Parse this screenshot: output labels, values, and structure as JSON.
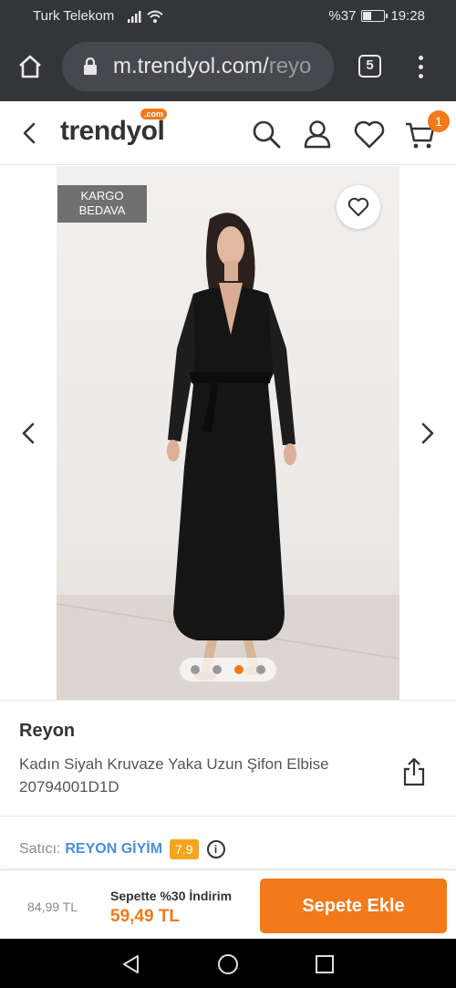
{
  "status_bar": {
    "carrier": "Turk Telekom",
    "battery": "%37",
    "time": "19:28",
    "battery_level": 0.37
  },
  "browser": {
    "url_main": "m.trendyol.com/",
    "url_rest": "reyo",
    "tab_count": "5"
  },
  "header": {
    "logo": "trendyol",
    "logo_com": ".com",
    "cart_count": "1"
  },
  "gallery": {
    "kargo_line1": "KARGO",
    "kargo_line2": "BEDAVA",
    "image_count": 4,
    "active_index": 2
  },
  "product": {
    "brand": "Reyon",
    "name": "Kadın Siyah Kruvaze Yaka Uzun Şifon Elbise 20794001D1D"
  },
  "seller": {
    "label": "Satıcı:",
    "name": "REYON GİYİM",
    "score": "7.9",
    "info_glyph": "i"
  },
  "purchase": {
    "old_price": "84,99 TL",
    "promo_text": "Sepette %30 İndirim",
    "new_price": "59,49 TL",
    "add_to_cart": "Sepete Ekle"
  },
  "colors": {
    "accent": "#f27a1a",
    "seller_link": "#4b8fd6",
    "score_badge": "#f4a51c"
  }
}
